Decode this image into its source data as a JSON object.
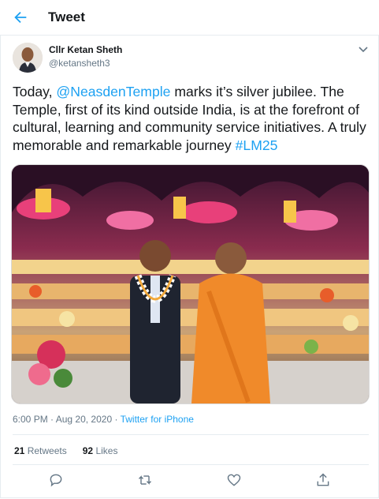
{
  "header": {
    "title": "Tweet"
  },
  "author": {
    "name": "Cllr Ketan Sheth",
    "handle": "@ketansheth3"
  },
  "tweet": {
    "text_1": "Today, ",
    "mention": "@NeasdenTemple",
    "text_2": " marks it’s silver jubilee. The Temple, first of its kind outside India, is at the forefront of cultural, learning and community service initiatives. A truly memorable and remarkable journey ",
    "hashtag": "#LM25"
  },
  "meta": {
    "time": "6:00 PM",
    "sep": " · ",
    "date": "Aug 20, 2020",
    "source": "Twitter for iPhone"
  },
  "stats": {
    "retweets_count": "21",
    "retweets_label": "Retweets",
    "likes_count": "92",
    "likes_label": "Likes"
  },
  "colors": {
    "accent": "#1da1f2",
    "muted": "#657786",
    "border": "#e6ecf0"
  }
}
